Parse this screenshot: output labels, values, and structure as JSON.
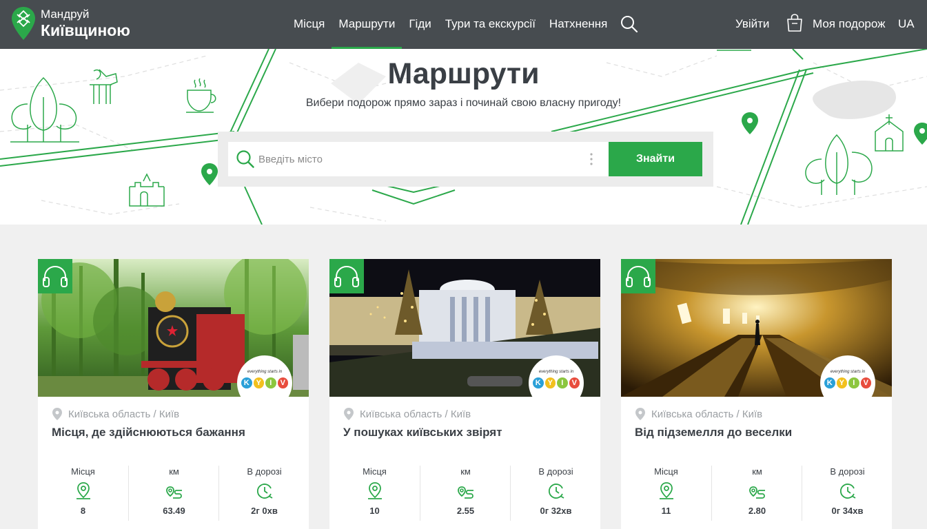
{
  "brand": {
    "line1": "Мандруй",
    "line2": "Київщиною"
  },
  "nav": {
    "items": [
      {
        "label": "Місця"
      },
      {
        "label": "Маршрути"
      },
      {
        "label": "Гіди"
      },
      {
        "label": "Тури та екскурсії"
      },
      {
        "label": "Натхнення"
      }
    ],
    "active": "Маршрути",
    "login": "Увійти",
    "my_trip": "Моя подорож",
    "lang": "UA"
  },
  "hero": {
    "title": "Маршрути",
    "subtitle": "Вибери подорож прямо зараз і починай свою власну пригоду!",
    "search_placeholder": "Введіть місто",
    "search_button": "Знайти"
  },
  "stat_labels": {
    "places": "Місця",
    "km": "км",
    "duration": "В дорозі"
  },
  "cards": [
    {
      "location": "Київська область / Київ",
      "title": "Місця, де здійснюються бажання",
      "places": "8",
      "km": "63.49",
      "duration": "2г 0хв"
    },
    {
      "location": "Київська область / Київ",
      "title": "У пошуках київських звірят",
      "places": "10",
      "km": "2.55",
      "duration": "0г 32хв"
    },
    {
      "location": "Київська область / Київ",
      "title": "Від підземелля до веселки",
      "places": "11",
      "km": "2.80",
      "duration": "0г 34хв"
    }
  ],
  "badge": {
    "caption": "everything starts in",
    "letters": [
      "K",
      "Y",
      "I",
      "V"
    ],
    "letter_colors": [
      "#2aa0d8",
      "#f2c01e",
      "#8cc63f",
      "#e84c3d"
    ]
  },
  "colors": {
    "accent": "#2ba84a",
    "header_bg": "#474c50",
    "text": "#3a3f45",
    "muted": "#9a9ea2"
  },
  "icons": {
    "audio": "headphones-icon",
    "location": "map-pin-icon",
    "search": "search-icon",
    "bag": "bag-icon",
    "places": "map-pin-icon",
    "km": "route-icon",
    "duration": "clock-icon"
  }
}
